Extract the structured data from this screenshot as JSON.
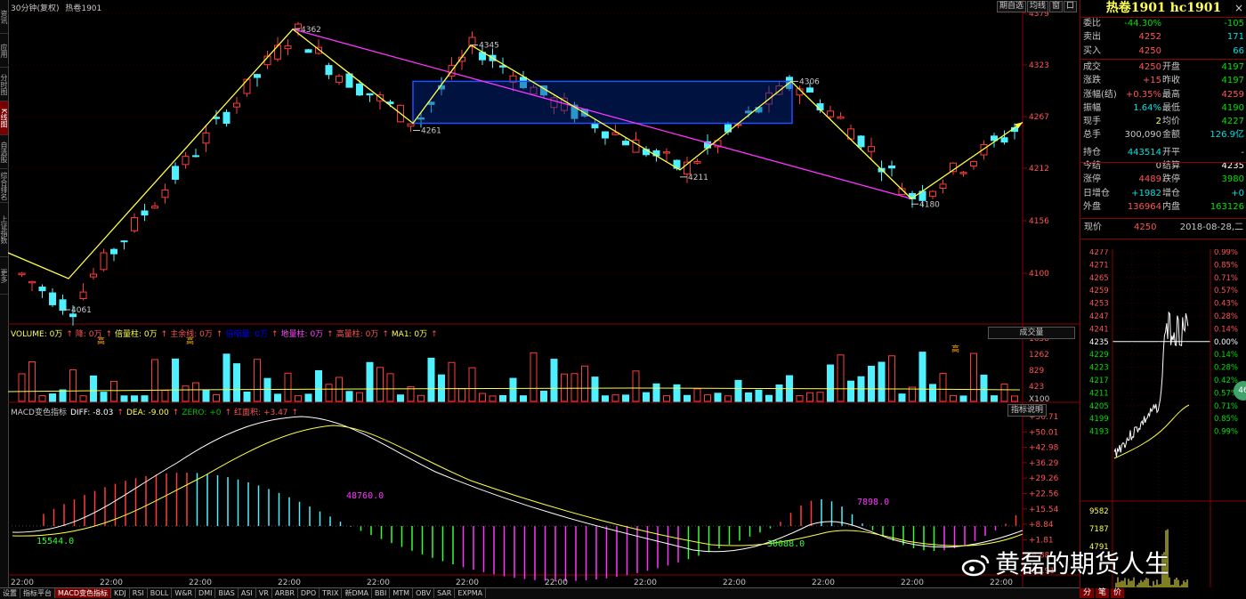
{
  "header": {
    "title": "30分钟(复权)",
    "symbol": "热卷1901",
    "buttons": [
      "期自选",
      "均线",
      "窗",
      "口"
    ]
  },
  "left_tabs": [
    "资讯",
    "应用",
    "分时图",
    "K线图",
    "自选股",
    "综合排名",
    "上证指数",
    "更多"
  ],
  "price_axis": [
    "4379",
    "4323",
    "4267",
    "4212",
    "4156",
    "4100"
  ],
  "price_labels": {
    "p1": "4362",
    "p2": "4345",
    "p3": "4261",
    "p4": "4306",
    "p5": "4211",
    "p6": "4180",
    "p7": "4061"
  },
  "volume": {
    "legend": [
      {
        "text": "VOLUME: 0万",
        "color": "#ffff54"
      },
      {
        "text": "降: 0万",
        "color": "#ff5555"
      },
      {
        "text": "倍量柱: 0万",
        "color": "#ffff54"
      },
      {
        "text": "主余线: 0万",
        "color": "#ff5555"
      },
      {
        "text": "倍缩量: 0万",
        "color": "#0000ff"
      },
      {
        "text": "地量柱: 0万",
        "color": "#ff44ff"
      },
      {
        "text": "高量柱: 0万",
        "color": "#ff5555"
      },
      {
        "text": "MA1: 0万",
        "color": "#ffff54"
      }
    ],
    "toggle_label": "成交量",
    "axis": [
      "1658",
      "1262",
      "829",
      "423",
      "X100"
    ],
    "marks": [
      "高",
      "高",
      "高"
    ]
  },
  "macd": {
    "legend": [
      {
        "text": "MACD变色指标",
        "color": "#c8c8c8"
      },
      {
        "text": "DIFF: -8.03",
        "color": "#ffffff"
      },
      {
        "text": "DEA: -9.00",
        "color": "#ffff54"
      },
      {
        "text": "ZERO: +0",
        "color": "#00c000"
      },
      {
        "text": "红面积: +3.47",
        "color": "#ff5555"
      }
    ],
    "help_label": "指标说明",
    "axis": [
      "+56.71",
      "+50.01",
      "+42.98",
      "+36.29",
      "+29.26",
      "+22.56",
      "+15.54",
      "+8.84",
      "+1.81",
      "-4.88",
      "-11.91"
    ],
    "areas": {
      "a1": "15544.0",
      "a2": "48760.0",
      "a3": "30088.0",
      "a4": "7898.0"
    }
  },
  "time_axis": [
    "22:00",
    "22:00",
    "22:00",
    "22:00",
    "22:00",
    "22:00",
    "22:00",
    "22:00",
    "22:00",
    "22:00",
    "22:00",
    "22:00"
  ],
  "bottom_tabs": [
    "设置",
    "指标平台",
    "MACD变色指标",
    "KDJ",
    "RSI",
    "BOLL",
    "W&R",
    "DMI",
    "BIAS",
    "ASI",
    "VR",
    "ARBR",
    "DPO",
    "TRIX",
    "新DMA",
    "BBI",
    "MTM",
    "OBV",
    "SAR",
    "EXPMA"
  ],
  "quote": {
    "title": "热卷1901 hc1901",
    "close_icon": "×",
    "rows": [
      {
        "l1": "委比",
        "v1": "-44.30%",
        "c1": "#00e000",
        "l2": "",
        "v2": "-105",
        "c2": "#00e000"
      },
      {
        "l1": "卖出",
        "v1": "4252",
        "c1": "#ff5555",
        "l2": "",
        "v2": "171",
        "c2": "#00e0e0"
      },
      {
        "l1": "买入",
        "v1": "4250",
        "c1": "#ff5555",
        "l2": "",
        "v2": "66",
        "c2": "#00e0e0"
      },
      {
        "l1": "成交",
        "v1": "4250",
        "c1": "#ff5555",
        "l2": "开盘",
        "v2": "4197",
        "c2": "#00e000"
      },
      {
        "l1": "涨跌",
        "v1": "+15",
        "c1": "#ff5555",
        "l2": "昨收",
        "v2": "4197",
        "c2": "#00e000"
      },
      {
        "l1": "涨幅(结)",
        "v1": "+0.35%",
        "c1": "#ff5555",
        "l2": "最高",
        "v2": "4259",
        "c2": "#ff5555"
      },
      {
        "l1": "振幅",
        "v1": "1.64%",
        "c1": "#00e0e0",
        "l2": "最低",
        "v2": "4190",
        "c2": "#00e000"
      },
      {
        "l1": "现手",
        "v1": "2",
        "c1": "#ffff54",
        "l2": "均价",
        "v2": "4227",
        "c2": "#00e000"
      },
      {
        "l1": "总手",
        "v1": "300,090",
        "c1": "#c8c8c8",
        "l2": "金额",
        "v2": "126.9亿",
        "c2": "#00e0e0"
      },
      {
        "l1": "持仓",
        "v1": "443514",
        "c1": "#00e0e0",
        "l2": "开平",
        "v2": "-",
        "c2": "#c8c8c8"
      },
      {
        "l1": "今结",
        "v1": "0",
        "c1": "#c8c8c8",
        "l2": "结算",
        "v2": "4235",
        "c2": "#ffffff"
      },
      {
        "l1": "涨停",
        "v1": "4489",
        "c1": "#ff5555",
        "l2": "跌停",
        "v2": "3980",
        "c2": "#00e000"
      },
      {
        "l1": "日增仓",
        "v1": "+1982",
        "c1": "#00e0e0",
        "l2": "增仓",
        "v2": "+0",
        "c2": "#00e0e0"
      },
      {
        "l1": "外盘",
        "v1": "136964",
        "c1": "#ff5555",
        "l2": "内盘",
        "v2": "163126",
        "c2": "#00e000"
      }
    ],
    "now_label": "现价",
    "now_value": "4250",
    "date": "2018-08-28,二"
  },
  "mini": {
    "price_axis": [
      "4277",
      "4271",
      "4265",
      "4259",
      "4253",
      "4247",
      "4241",
      "4235",
      "4229",
      "4223",
      "4217",
      "4211",
      "4205",
      "4199",
      "4193"
    ],
    "pct_axis": [
      "0.99%",
      "0.85%",
      "0.71%",
      "0.57%",
      "0.43%",
      "0.28%",
      "0.14%",
      "0.00%",
      "0.14%",
      "0.28%",
      "0.42%",
      "0.57%",
      "0.71%",
      "0.85%",
      "0.99%"
    ],
    "vol_axis": [
      "9582",
      "7187",
      "4791"
    ]
  },
  "right_bottom_tabs": [
    "分",
    "笔",
    "价"
  ],
  "badge": "46",
  "watermark": "黄磊的期货人生"
}
